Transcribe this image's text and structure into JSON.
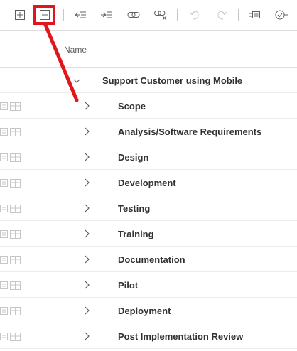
{
  "toolbar": {
    "buttons": [
      {
        "name": "expand-all-button",
        "icon": "plus-square-icon"
      },
      {
        "name": "collapse-all-button",
        "icon": "minus-square-icon"
      },
      {
        "name": "outdent-button",
        "icon": "outdent-icon"
      },
      {
        "name": "indent-button",
        "icon": "indent-icon"
      },
      {
        "name": "link-button",
        "icon": "link-icon"
      },
      {
        "name": "unlink-button",
        "icon": "unlink-icon"
      },
      {
        "name": "undo-button",
        "icon": "undo-icon"
      },
      {
        "name": "redo-button",
        "icon": "redo-icon"
      },
      {
        "name": "details-button",
        "icon": "details-icon"
      },
      {
        "name": "assign-button",
        "icon": "check-circle-icon"
      }
    ],
    "highlight_color": "#e0161c"
  },
  "grid": {
    "name_header": "Name",
    "parent_task": "Support Customer using Mobile",
    "tasks": [
      "Scope",
      "Analysis/Software Requirements",
      "Design",
      "Development",
      "Testing",
      "Training",
      "Documentation",
      "Pilot",
      "Deployment",
      "Post Implementation Review"
    ]
  }
}
